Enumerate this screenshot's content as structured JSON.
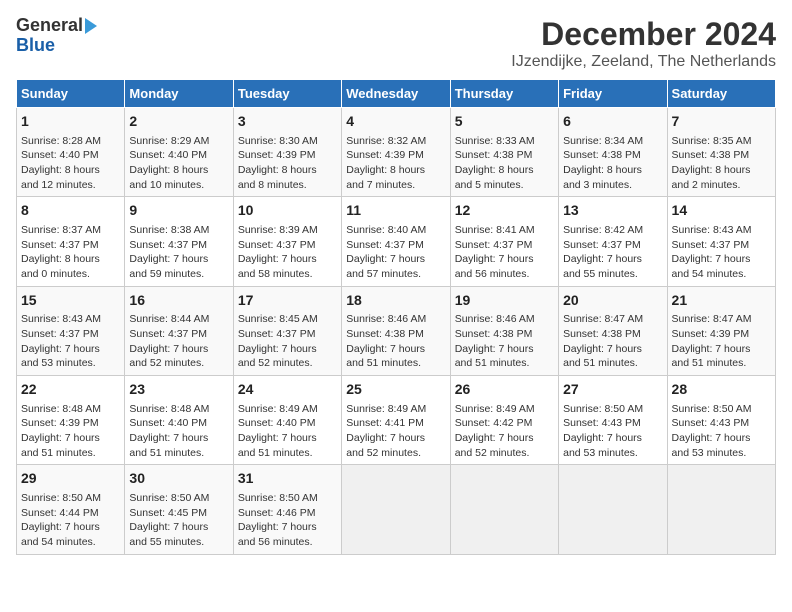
{
  "header": {
    "logo_line1": "General",
    "logo_line2": "Blue",
    "title": "December 2024",
    "subtitle": "IJzendijke, Zeeland, The Netherlands"
  },
  "columns": [
    "Sunday",
    "Monday",
    "Tuesday",
    "Wednesday",
    "Thursday",
    "Friday",
    "Saturday"
  ],
  "weeks": [
    [
      {
        "day": "1",
        "info": "Sunrise: 8:28 AM\nSunset: 4:40 PM\nDaylight: 8 hours\nand 12 minutes."
      },
      {
        "day": "2",
        "info": "Sunrise: 8:29 AM\nSunset: 4:40 PM\nDaylight: 8 hours\nand 10 minutes."
      },
      {
        "day": "3",
        "info": "Sunrise: 8:30 AM\nSunset: 4:39 PM\nDaylight: 8 hours\nand 8 minutes."
      },
      {
        "day": "4",
        "info": "Sunrise: 8:32 AM\nSunset: 4:39 PM\nDaylight: 8 hours\nand 7 minutes."
      },
      {
        "day": "5",
        "info": "Sunrise: 8:33 AM\nSunset: 4:38 PM\nDaylight: 8 hours\nand 5 minutes."
      },
      {
        "day": "6",
        "info": "Sunrise: 8:34 AM\nSunset: 4:38 PM\nDaylight: 8 hours\nand 3 minutes."
      },
      {
        "day": "7",
        "info": "Sunrise: 8:35 AM\nSunset: 4:38 PM\nDaylight: 8 hours\nand 2 minutes."
      }
    ],
    [
      {
        "day": "8",
        "info": "Sunrise: 8:37 AM\nSunset: 4:37 PM\nDaylight: 8 hours\nand 0 minutes."
      },
      {
        "day": "9",
        "info": "Sunrise: 8:38 AM\nSunset: 4:37 PM\nDaylight: 7 hours\nand 59 minutes."
      },
      {
        "day": "10",
        "info": "Sunrise: 8:39 AM\nSunset: 4:37 PM\nDaylight: 7 hours\nand 58 minutes."
      },
      {
        "day": "11",
        "info": "Sunrise: 8:40 AM\nSunset: 4:37 PM\nDaylight: 7 hours\nand 57 minutes."
      },
      {
        "day": "12",
        "info": "Sunrise: 8:41 AM\nSunset: 4:37 PM\nDaylight: 7 hours\nand 56 minutes."
      },
      {
        "day": "13",
        "info": "Sunrise: 8:42 AM\nSunset: 4:37 PM\nDaylight: 7 hours\nand 55 minutes."
      },
      {
        "day": "14",
        "info": "Sunrise: 8:43 AM\nSunset: 4:37 PM\nDaylight: 7 hours\nand 54 minutes."
      }
    ],
    [
      {
        "day": "15",
        "info": "Sunrise: 8:43 AM\nSunset: 4:37 PM\nDaylight: 7 hours\nand 53 minutes."
      },
      {
        "day": "16",
        "info": "Sunrise: 8:44 AM\nSunset: 4:37 PM\nDaylight: 7 hours\nand 52 minutes."
      },
      {
        "day": "17",
        "info": "Sunrise: 8:45 AM\nSunset: 4:37 PM\nDaylight: 7 hours\nand 52 minutes."
      },
      {
        "day": "18",
        "info": "Sunrise: 8:46 AM\nSunset: 4:38 PM\nDaylight: 7 hours\nand 51 minutes."
      },
      {
        "day": "19",
        "info": "Sunrise: 8:46 AM\nSunset: 4:38 PM\nDaylight: 7 hours\nand 51 minutes."
      },
      {
        "day": "20",
        "info": "Sunrise: 8:47 AM\nSunset: 4:38 PM\nDaylight: 7 hours\nand 51 minutes."
      },
      {
        "day": "21",
        "info": "Sunrise: 8:47 AM\nSunset: 4:39 PM\nDaylight: 7 hours\nand 51 minutes."
      }
    ],
    [
      {
        "day": "22",
        "info": "Sunrise: 8:48 AM\nSunset: 4:39 PM\nDaylight: 7 hours\nand 51 minutes."
      },
      {
        "day": "23",
        "info": "Sunrise: 8:48 AM\nSunset: 4:40 PM\nDaylight: 7 hours\nand 51 minutes."
      },
      {
        "day": "24",
        "info": "Sunrise: 8:49 AM\nSunset: 4:40 PM\nDaylight: 7 hours\nand 51 minutes."
      },
      {
        "day": "25",
        "info": "Sunrise: 8:49 AM\nSunset: 4:41 PM\nDaylight: 7 hours\nand 52 minutes."
      },
      {
        "day": "26",
        "info": "Sunrise: 8:49 AM\nSunset: 4:42 PM\nDaylight: 7 hours\nand 52 minutes."
      },
      {
        "day": "27",
        "info": "Sunrise: 8:50 AM\nSunset: 4:43 PM\nDaylight: 7 hours\nand 53 minutes."
      },
      {
        "day": "28",
        "info": "Sunrise: 8:50 AM\nSunset: 4:43 PM\nDaylight: 7 hours\nand 53 minutes."
      }
    ],
    [
      {
        "day": "29",
        "info": "Sunrise: 8:50 AM\nSunset: 4:44 PM\nDaylight: 7 hours\nand 54 minutes."
      },
      {
        "day": "30",
        "info": "Sunrise: 8:50 AM\nSunset: 4:45 PM\nDaylight: 7 hours\nand 55 minutes."
      },
      {
        "day": "31",
        "info": "Sunrise: 8:50 AM\nSunset: 4:46 PM\nDaylight: 7 hours\nand 56 minutes."
      },
      {
        "day": "",
        "info": ""
      },
      {
        "day": "",
        "info": ""
      },
      {
        "day": "",
        "info": ""
      },
      {
        "day": "",
        "info": ""
      }
    ]
  ]
}
